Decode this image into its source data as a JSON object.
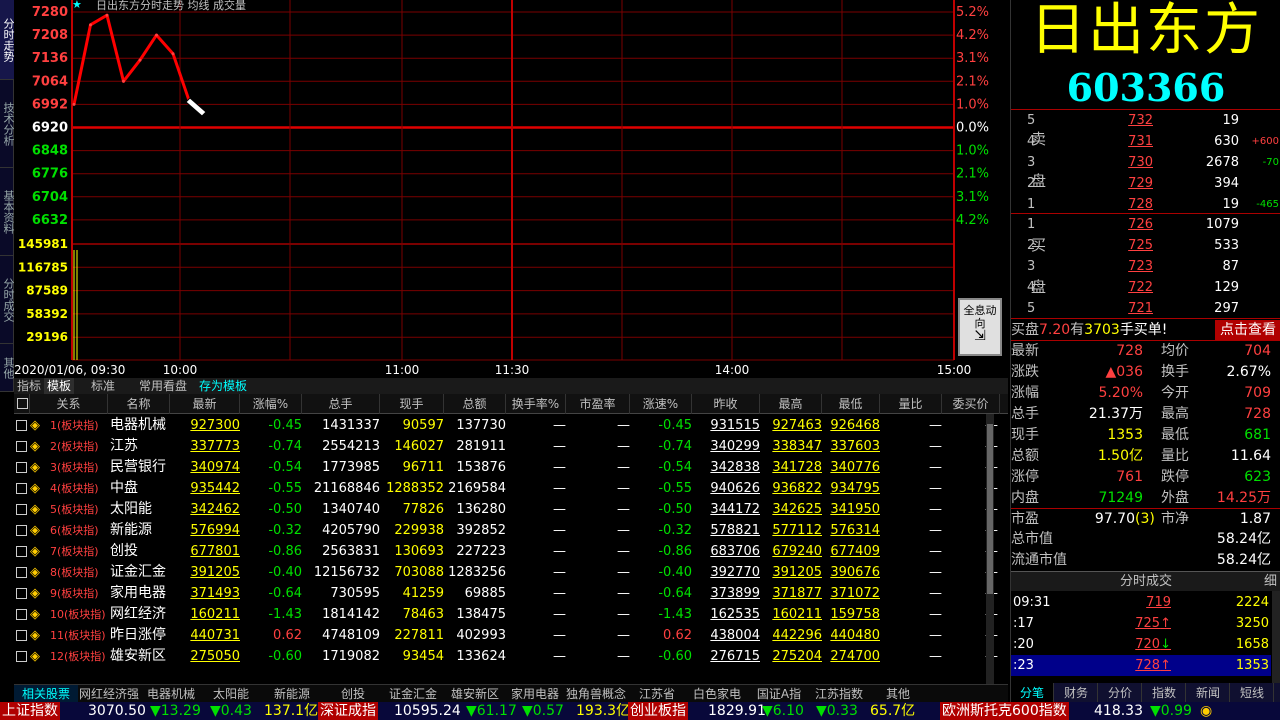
{
  "side_tabs": [
    "分时走势",
    "技术分析",
    "基本资料",
    "分时成交",
    "其他"
  ],
  "chart": {
    "title": "日出东方分时走势 均线 成交量",
    "price_ticks_left": [
      "7280",
      "7208",
      "7136",
      "7064",
      "6992",
      "6920",
      "6848",
      "6776",
      "6704",
      "6632"
    ],
    "pct_ticks_right": [
      "5.2%",
      "4.2%",
      "3.1%",
      "2.1%",
      "1.0%",
      "0.0%",
      "1.0%",
      "2.1%",
      "3.1%",
      "4.2%"
    ],
    "volume_ticks": [
      "145981",
      "116785",
      "87589",
      "58392",
      "29196"
    ],
    "date_label": "2020/01/06, 09:30",
    "time_labels": [
      "10:00",
      "11:00",
      "11:30",
      "14:00",
      "15:00"
    ],
    "info_button": "全息动向"
  },
  "chart_data": {
    "type": "line",
    "title": "日出东方分时走势 均线 成交量",
    "x": [
      "09:30",
      "09:31",
      "09:33",
      "09:36",
      "09:40",
      "09:44",
      "09:48",
      "09:51"
    ],
    "series": [
      {
        "name": "",
        "values": [
          6992,
          7240,
          7270,
          7064,
          7130,
          7208,
          7150,
          7000
        ]
      }
    ],
    "ylim": [
      6632,
      7280
    ],
    "xlabel": "",
    "ylabel": "",
    "grid": true
  },
  "mid_tabs": [
    "指标",
    "模板",
    "标准",
    "常用看盘",
    "存为模板"
  ],
  "table": {
    "headers": [
      "",
      "关系",
      "名称",
      "最新",
      "涨幅%",
      "总手",
      "现手",
      "总额",
      "换手率%",
      "市盈率",
      "涨速%",
      "昨收",
      "最高",
      "最低",
      "量比",
      "委买价"
    ],
    "rows": [
      {
        "idx": "1",
        "rel": "(板块指)",
        "name": "电器机械",
        "last": "927300",
        "chg": "-0.45",
        "vol": "1431337",
        "cur": "90597",
        "amt": "137730",
        "turn": "—",
        "pe": "—",
        "speed": "-0.45",
        "prev": "931515",
        "high": "927463",
        "low": "926468",
        "vr": "—",
        "bid": "—"
      },
      {
        "idx": "2",
        "rel": "(板块指)",
        "name": "江苏",
        "last": "337773",
        "chg": "-0.74",
        "vol": "2554213",
        "cur": "146027",
        "amt": "281911",
        "turn": "—",
        "pe": "—",
        "speed": "-0.74",
        "prev": "340299",
        "high": "338347",
        "low": "337603",
        "vr": "—",
        "bid": "—"
      },
      {
        "idx": "3",
        "rel": "(板块指)",
        "name": "民营银行",
        "last": "340974",
        "chg": "-0.54",
        "vol": "1773985",
        "cur": "96711",
        "amt": "153876",
        "turn": "—",
        "pe": "—",
        "speed": "-0.54",
        "prev": "342838",
        "high": "341728",
        "low": "340776",
        "vr": "—",
        "bid": "—"
      },
      {
        "idx": "4",
        "rel": "(板块指)",
        "name": "中盘",
        "last": "935442",
        "chg": "-0.55",
        "vol": "21168846",
        "cur": "1288352",
        "amt": "2169584",
        "turn": "—",
        "pe": "—",
        "speed": "-0.55",
        "prev": "940626",
        "high": "936822",
        "low": "934795",
        "vr": "—",
        "bid": "—"
      },
      {
        "idx": "5",
        "rel": "(板块指)",
        "name": "太阳能",
        "last": "342462",
        "chg": "-0.50",
        "vol": "1340740",
        "cur": "77826",
        "amt": "136280",
        "turn": "—",
        "pe": "—",
        "speed": "-0.50",
        "prev": "344172",
        "high": "342625",
        "low": "341950",
        "vr": "—",
        "bid": "—"
      },
      {
        "idx": "6",
        "rel": "(板块指)",
        "name": "新能源",
        "last": "576994",
        "chg": "-0.32",
        "vol": "4205790",
        "cur": "229938",
        "amt": "392852",
        "turn": "—",
        "pe": "—",
        "speed": "-0.32",
        "prev": "578821",
        "high": "577112",
        "low": "576314",
        "vr": "—",
        "bid": "—"
      },
      {
        "idx": "7",
        "rel": "(板块指)",
        "name": "创投",
        "last": "677801",
        "chg": "-0.86",
        "vol": "2563831",
        "cur": "130693",
        "amt": "227223",
        "turn": "—",
        "pe": "—",
        "speed": "-0.86",
        "prev": "683706",
        "high": "679240",
        "low": "677409",
        "vr": "—",
        "bid": "—"
      },
      {
        "idx": "8",
        "rel": "(板块指)",
        "name": "证金汇金",
        "last": "391205",
        "chg": "-0.40",
        "vol": "12156732",
        "cur": "703088",
        "amt": "1283256",
        "turn": "—",
        "pe": "—",
        "speed": "-0.40",
        "prev": "392770",
        "high": "391205",
        "low": "390676",
        "vr": "—",
        "bid": "—"
      },
      {
        "idx": "9",
        "rel": "(板块指)",
        "name": "家用电器",
        "last": "371493",
        "chg": "-0.64",
        "vol": "730595",
        "cur": "41259",
        "amt": "69885",
        "turn": "—",
        "pe": "—",
        "speed": "-0.64",
        "prev": "373899",
        "high": "371877",
        "low": "371072",
        "vr": "—",
        "bid": "—"
      },
      {
        "idx": "10",
        "rel": "(板块指)",
        "name": "网红经济",
        "last": "160211",
        "chg": "-1.43",
        "vol": "1814142",
        "cur": "78463",
        "amt": "138475",
        "turn": "—",
        "pe": "—",
        "speed": "-1.43",
        "prev": "162535",
        "high": "160211",
        "low": "159758",
        "vr": "—",
        "bid": "—"
      },
      {
        "idx": "11",
        "rel": "(板块指)",
        "name": "昨日涨停",
        "last": "440731",
        "chg": "0.62",
        "vol": "4748109",
        "cur": "227811",
        "amt": "402993",
        "turn": "—",
        "pe": "—",
        "speed": "0.62",
        "prev": "438004",
        "high": "442296",
        "low": "440480",
        "vr": "—",
        "bid": "—"
      },
      {
        "idx": "12",
        "rel": "(板块指)",
        "name": "雄安新区",
        "last": "275050",
        "chg": "-0.60",
        "vol": "1719082",
        "cur": "93454",
        "amt": "133624",
        "turn": "—",
        "pe": "—",
        "speed": "-0.60",
        "prev": "276715",
        "high": "275204",
        "low": "274700",
        "vr": "—",
        "bid": "—"
      }
    ]
  },
  "sector_tabs": [
    "相关股票",
    "网红经济强",
    "电器机械",
    "太阳能",
    "新能源",
    "创投",
    "证金汇金",
    "雄安新区",
    "家用电器",
    "独角兽概念",
    "江苏省",
    "白色家电",
    "国证A指",
    "江苏指数",
    "其他"
  ],
  "stock": {
    "name": "日出东方",
    "code": "603366",
    "sell_label": [
      "卖",
      "盘"
    ],
    "buy_label": [
      "买",
      "盘"
    ],
    "asks": [
      {
        "lvl": "5",
        "px": "732",
        "vol": "19",
        "chg": ""
      },
      {
        "lvl": "4",
        "px": "731",
        "vol": "630",
        "chg": "+600"
      },
      {
        "lvl": "3",
        "px": "730",
        "vol": "2678",
        "chg": "-70"
      },
      {
        "lvl": "2",
        "px": "729",
        "vol": "394",
        "chg": ""
      },
      {
        "lvl": "1",
        "px": "728",
        "vol": "19",
        "chg": "-465"
      }
    ],
    "bids": [
      {
        "lvl": "1",
        "px": "726",
        "vol": "1079"
      },
      {
        "lvl": "2",
        "px": "725",
        "vol": "533"
      },
      {
        "lvl": "3",
        "px": "723",
        "vol": "87"
      },
      {
        "lvl": "4",
        "px": "722",
        "vol": "129"
      },
      {
        "lvl": "5",
        "px": "721",
        "vol": "297"
      }
    ],
    "buy_order": {
      "prefix": "买盘",
      "price": "7.20",
      "mid": "有",
      "qty": "3703",
      "suffix": "手买单!",
      "button": "点击查看"
    },
    "quote": [
      {
        "l1": "最新",
        "v1": "728",
        "c1": "red",
        "l2": "均价",
        "v2": "704",
        "c2": "red"
      },
      {
        "l1": "涨跌",
        "v1": "▲036",
        "c1": "red",
        "l2": "换手",
        "v2": "2.67%",
        "c2": "wht"
      },
      {
        "l1": "涨幅",
        "v1": "5.20%",
        "c1": "red",
        "l2": "今开",
        "v2": "709",
        "c2": "red"
      },
      {
        "l1": "总手",
        "v1": "21.37万",
        "c1": "wht",
        "l2": "最高",
        "v2": "728",
        "c2": "red"
      },
      {
        "l1": "现手",
        "v1": "1353",
        "c1": "yel",
        "l2": "最低",
        "v2": "681",
        "c2": "grn"
      },
      {
        "l1": "总额",
        "v1": "1.50亿",
        "c1": "yel",
        "l2": "量比",
        "v2": "11.64",
        "c2": "wht"
      },
      {
        "l1": "涨停",
        "v1": "761",
        "c1": "red",
        "l2": "跌停",
        "v2": "623",
        "c2": "grn"
      },
      {
        "l1": "内盘",
        "v1": "71249",
        "c1": "grn",
        "l2": "外盘",
        "v2": "14.25万",
        "c2": "red"
      }
    ],
    "pe": {
      "l": "市盈",
      "v": "97.70",
      "badge": "3",
      "l2": "市净",
      "v2": "1.87"
    },
    "mktcap": {
      "l": "总市值",
      "v": "58.24亿"
    },
    "floatcap": {
      "l": "流通市值",
      "v": "58.24亿"
    }
  },
  "ticks": {
    "title": "分时成交",
    "btn": "细",
    "rows": [
      {
        "t": "09:31",
        "p": "719",
        "arrow": "",
        "v": "2224"
      },
      {
        "t": ":17",
        "p": "725",
        "arrow": "↑",
        "v": "3250"
      },
      {
        "t": ":20",
        "p": "720",
        "arrow": "↓",
        "v": "1658"
      },
      {
        "t": ":23",
        "p": "728",
        "arrow": "↑",
        "v": "1353"
      }
    ]
  },
  "rp_tabs": [
    "分笔",
    "财务",
    "分价",
    "指数",
    "新闻",
    "短线"
  ],
  "index_bar": [
    {
      "name": "上证指数",
      "val": "3070.50",
      "chg": "▼13.29",
      "pct": "▼0.43",
      "amt": "137.1亿"
    },
    {
      "name": "深证成指",
      "val": "10595.24",
      "chg": "▼61.17",
      "pct": "▼0.57",
      "amt": "193.3亿"
    },
    {
      "name": "创业板指",
      "val": "1829.91",
      "chg": "▼6.10",
      "pct": "▼0.33",
      "amt": "65.7亿"
    },
    {
      "name": "欧洲斯托克600指数",
      "val": "418.33",
      "chg": "▼0.99",
      "pct": "",
      "amt": ""
    }
  ]
}
